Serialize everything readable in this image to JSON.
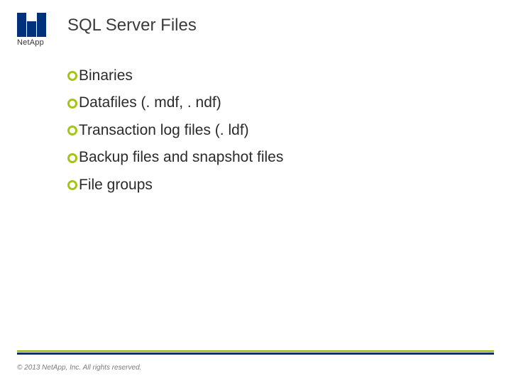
{
  "logo": {
    "text": "NetApp"
  },
  "title": "SQL Server Files",
  "bullets": [
    "Binaries",
    "Datafiles (. mdf, . ndf)",
    "Transaction log files (. ldf)",
    "Backup files and snapshot files",
    "File groups"
  ],
  "copyright": "© 2013 NetApp, Inc. All rights reserved."
}
